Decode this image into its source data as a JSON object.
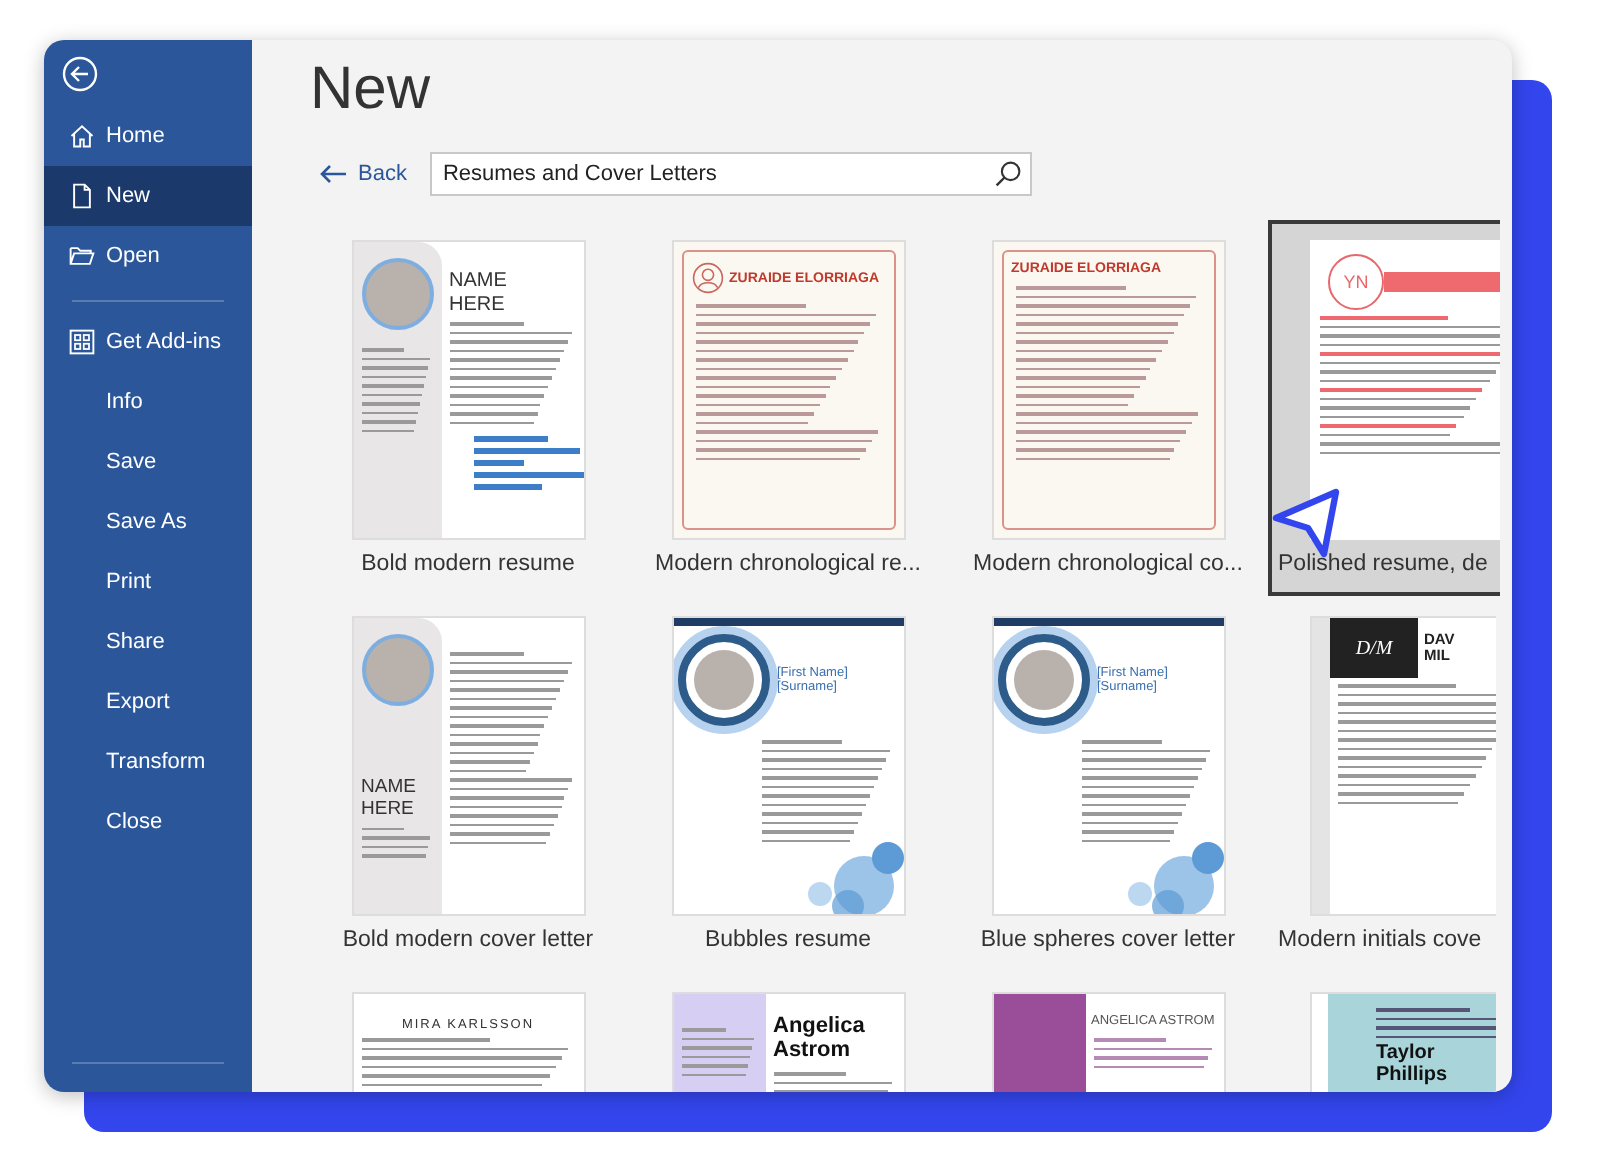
{
  "sidebar": {
    "items": [
      {
        "label": "Home",
        "kind": "home",
        "selected": false
      },
      {
        "label": "New",
        "kind": "document",
        "selected": true
      },
      {
        "label": "Open",
        "kind": "folder",
        "selected": false
      },
      {
        "label": "Get Add-ins",
        "kind": "addins",
        "selected": false,
        "divider_before": true
      },
      {
        "label": "Info",
        "selected": false
      },
      {
        "label": "Save",
        "selected": false
      },
      {
        "label": "Save As",
        "selected": false
      },
      {
        "label": "Print",
        "selected": false
      },
      {
        "label": "Share",
        "selected": false
      },
      {
        "label": "Export",
        "selected": false
      },
      {
        "label": "Transform",
        "selected": false
      },
      {
        "label": "Close",
        "selected": false
      }
    ]
  },
  "page_title": "New",
  "back_link": "Back",
  "search": {
    "value": "Resumes and Cover Letters"
  },
  "templates": [
    {
      "label": "Bold modern resume",
      "selected": false,
      "kind": "bold-resume",
      "heading": "NAME HERE"
    },
    {
      "label": "Modern chronological re...",
      "selected": false,
      "kind": "chrono-resume",
      "heading": "ZURAIDE ELORRIAGA"
    },
    {
      "label": "Modern chronological co...",
      "selected": false,
      "kind": "chrono-letter",
      "heading": "ZURAIDE ELORRIAGA"
    },
    {
      "label": "Polished resume, de",
      "selected": true,
      "kind": "polished",
      "heading": "YN"
    },
    {
      "label": "Bold modern cover letter",
      "selected": false,
      "kind": "bold-letter",
      "heading": "NAME HERE"
    },
    {
      "label": "Bubbles resume",
      "selected": false,
      "kind": "bubbles",
      "heading": "[First Name] [Surname]"
    },
    {
      "label": "Blue spheres cover letter",
      "selected": false,
      "kind": "bubbles-letter",
      "heading": "[First Name] [Surname]"
    },
    {
      "label": "Modern initials cove",
      "selected": false,
      "kind": "initials",
      "heading": "D/M",
      "subheading": "DAV MIL"
    },
    {
      "selected": false,
      "kind": "karlsson",
      "heading": "MIRA KARLSSON"
    },
    {
      "selected": false,
      "kind": "angelica",
      "heading": "Angelica Astrom"
    },
    {
      "selected": false,
      "kind": "angelica-letter",
      "heading": "ANGELICA ASTROM"
    },
    {
      "selected": false,
      "kind": "taylor",
      "heading": "Taylor Phillips"
    }
  ]
}
